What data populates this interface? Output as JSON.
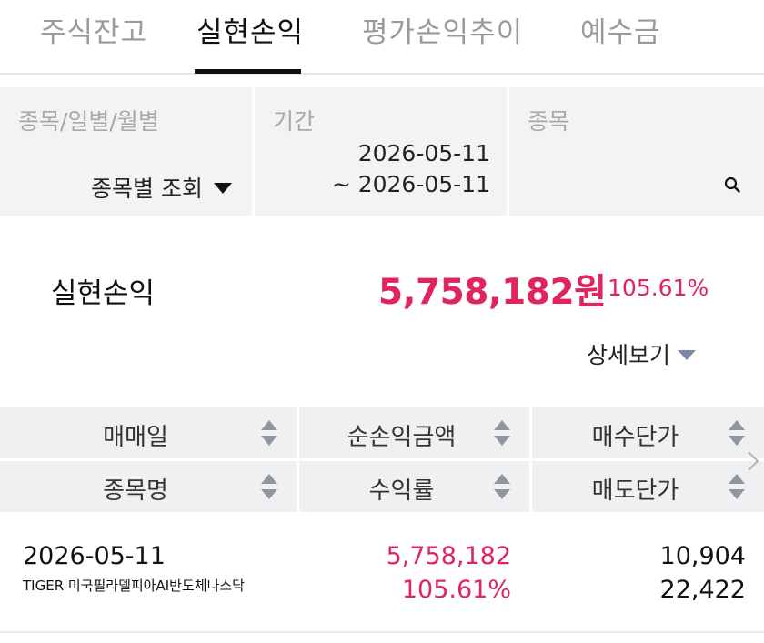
{
  "tabs": [
    {
      "label": "주식잔고"
    },
    {
      "label": "실현손익"
    },
    {
      "label": "평가손익추이"
    },
    {
      "label": "예수금"
    }
  ],
  "filters": {
    "type": {
      "label": "종목/일별/월별",
      "value": "종목별 조회"
    },
    "period": {
      "label": "기간",
      "start": "2026-05-11",
      "end": "~ 2026-05-11"
    },
    "stock": {
      "label": "종목",
      "value": ""
    }
  },
  "summary": {
    "label": "실현손익",
    "amount": "5,758,182원",
    "rate": "105.61%",
    "detail_label": "상세보기"
  },
  "table": {
    "headers_row1": [
      "매매일",
      "순손익금액",
      "매수단가"
    ],
    "headers_row2": [
      "종목명",
      "수익률",
      "매도단가"
    ],
    "rows": [
      {
        "date": "2026-05-11",
        "name": "TIGER 미국필라델피아AI반도체나스닥",
        "net_profit": "5,758,182",
        "rate": "105.61%",
        "buy_price": "10,904",
        "sell_price": "22,422"
      }
    ]
  },
  "colors": {
    "accent_red": "#e0245e",
    "header_bg": "#eef0f2",
    "filter_bg": "#f2f3f5"
  },
  "icons": {
    "search": "search-icon",
    "sort": "sort-icon",
    "dropdown": "caret-down-icon",
    "scroll": "chevron-right-icon"
  }
}
